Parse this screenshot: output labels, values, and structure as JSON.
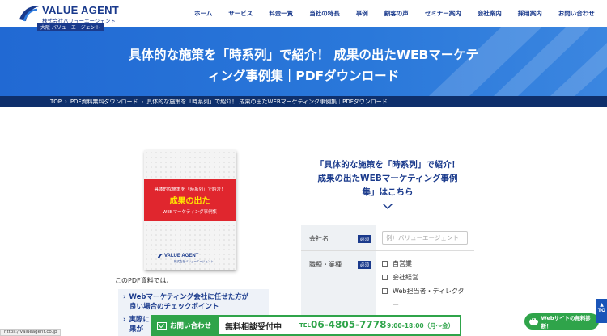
{
  "header": {
    "logo_text": "VALUE AGENT",
    "logo_sub": "株式会社バリューエージェント",
    "logo_tag": "大阪 バリューエージェント",
    "nav": [
      "ホーム",
      "サービス",
      "料金一覧",
      "当社の特長",
      "事例",
      "顧客の声",
      "セミナー案内",
      "会社案内",
      "採用案内",
      "お問い合わせ"
    ]
  },
  "hero": {
    "title_line1": "具体的な施策を「時系列」で紹介！ 成果の出たWEBマーケテ",
    "title_line2": "ィング事例集｜PDFダウンロード"
  },
  "breadcrumb": [
    "TOP",
    "PDF資料無料ダウンロード",
    "具体的な施策を「時系列」で紹介！ 成果の出たWEBマーケティング事例集｜PDFダウンロード"
  ],
  "booklet": {
    "line1": "具体的な施策を「時系列」で紹介！",
    "line2": "成果の出た",
    "line3": "WEBマーケティング事例集",
    "logo": "VALUE AGENT",
    "logo_sub": "株式会社バリューエージェント"
  },
  "intro": "このPDF資料では、",
  "features": [
    "Webマーケティング会社に任せた方が",
    "良い場合のチェックポイント",
    "実際に",
    "果が"
  ],
  "form": {
    "title_line1": "「具体的な施策を「時系列」で紹介！",
    "title_line2": "成果の出たWEBマーケティング事例",
    "title_line3": "集」はこちら",
    "company_label": "会社名",
    "required": "必須",
    "company_placeholder": "例）バリューエージェント",
    "role_label": "職種・業種",
    "options": [
      "自営業",
      "会社経営",
      "Web担当者・ディレクタ",
      "ー"
    ]
  },
  "cta": {
    "contact_label": "お問い合わせ",
    "free_consult": "無料相談受付中",
    "tel_prefix": "TEL",
    "tel": "06-4805-7778",
    "hours": "9:00-18:00（月〜金）"
  },
  "status_url": "https://valueagent.co.jp",
  "chat_label": "Webサイトの無料診断！",
  "top_label": "TO",
  "colors": {
    "brand": "#1a3a8c",
    "hero": "#2169d3",
    "green": "#2fa44a",
    "red": "#e0262e"
  }
}
